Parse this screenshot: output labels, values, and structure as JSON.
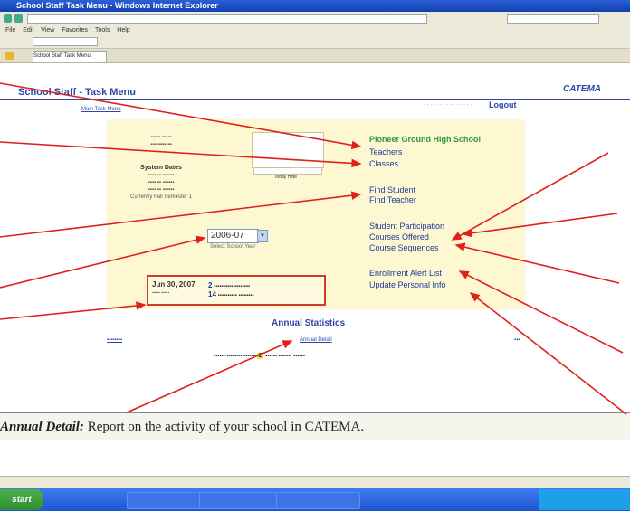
{
  "browser": {
    "window_title": "School Staff Task Menu - Windows Internet Explorer",
    "tab_label": "School Staff Task Menu"
  },
  "menu": [
    "File",
    "Edit",
    "View",
    "Favorites",
    "Tools",
    "Help"
  ],
  "app": {
    "title": "School Staff - Task Menu",
    "logo": "CATEMA",
    "logout": "Logout",
    "main_link": "Main Task Menu"
  },
  "school_menu": {
    "school_name": "Pioneer Ground High School",
    "links": [
      "Teachers",
      "Classes",
      "Find Student",
      "Find Teacher",
      "Student Participation",
      "Courses Offered",
      "Course Sequences",
      "Enrollment Alert List",
      "Update Personal Info"
    ]
  },
  "system": {
    "heading": "System Dates",
    "current": "Currently Fall Semester 1"
  },
  "calendar": {
    "buttons": "Today  Hide"
  },
  "year_select": {
    "value": "2006-07",
    "caption": "Select School Year"
  },
  "alert": {
    "date": "Jun 30, 2007",
    "count1": "2",
    "count2": "14"
  },
  "annual": {
    "title": "Annual Statistics",
    "detail_link": "Annual Detail",
    "figure": "2"
  },
  "caption": {
    "term": "Annual Detail:",
    "text": " Report on the activity of your school in CATEMA."
  },
  "taskbar": {
    "start": "start"
  },
  "colors": {
    "title_blue": "#2f46a8",
    "school_green": "#2f9a3a",
    "arrow_red": "#e0201a",
    "panel_yellow": "#fdf8d2"
  }
}
